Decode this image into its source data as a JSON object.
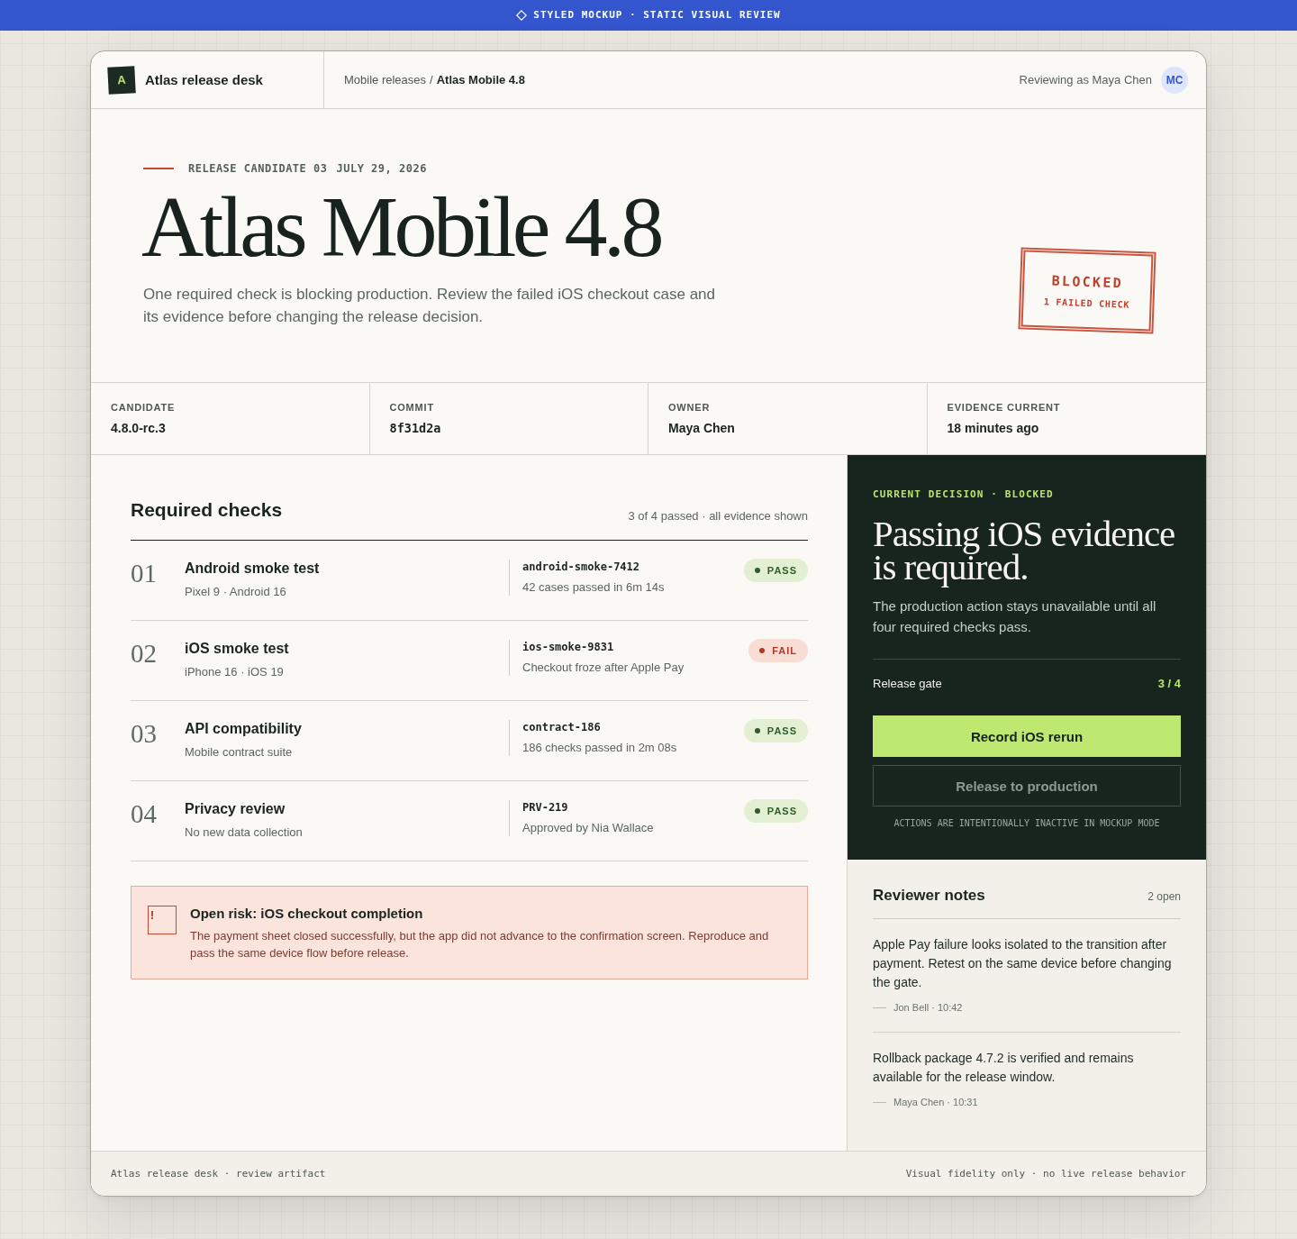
{
  "banner": {
    "text": "STYLED MOCKUP · STATIC VISUAL REVIEW"
  },
  "header": {
    "logo_letter": "A",
    "app_name": "Atlas release desk",
    "breadcrumb": [
      {
        "label": "Mobile releases",
        "current": false
      },
      {
        "label": "Atlas Mobile 4.8",
        "current": true
      }
    ],
    "separator": "/",
    "reviewer_text": "Reviewing as Maya Chen",
    "avatar_initials": "MC"
  },
  "hero": {
    "eyebrow": "RELEASE CANDIDATE 03",
    "date": "JULY 29, 2026",
    "title": "Atlas Mobile 4.8",
    "summary": "One required check is blocking production. Review the failed iOS checkout case and its evidence before changing the release decision.",
    "stamp": {
      "label": "BLOCKED",
      "detail": "1 FAILED CHECK"
    }
  },
  "meta": [
    {
      "label": "CANDIDATE",
      "value": "4.8.0-rc.3",
      "kind": "text"
    },
    {
      "label": "COMMIT",
      "value": "8f31d2a",
      "kind": "code"
    },
    {
      "label": "OWNER",
      "value": "Maya Chen",
      "kind": "text"
    },
    {
      "label": "EVIDENCE CURRENT",
      "value": "18 minutes ago",
      "kind": "text"
    }
  ],
  "checks": {
    "title": "Required checks",
    "summary": "3 of 4 passed · all evidence shown",
    "items": [
      {
        "number": "01",
        "name": "Android smoke test",
        "device": "Pixel 9 · Android 16",
        "evidence_id": "android-smoke-7412",
        "evidence_detail": "42 cases passed in 6m 14s",
        "kind": "pass",
        "badge": "PASS"
      },
      {
        "number": "02",
        "name": "iOS smoke test",
        "device": "iPhone 16 · iOS 19",
        "evidence_id": "ios-smoke-9831",
        "evidence_detail": "Checkout froze after Apple Pay",
        "kind": "fail",
        "badge": "FAIL"
      },
      {
        "number": "03",
        "name": "API compatibility",
        "device": "Mobile contract suite",
        "evidence_id": "contract-186",
        "evidence_detail": "186 checks passed in 2m 08s",
        "kind": "pass",
        "badge": "PASS"
      },
      {
        "number": "04",
        "name": "Privacy review",
        "device": "No new data collection",
        "evidence_id": "PRV-219",
        "evidence_detail": "Approved by Nia Wallace",
        "kind": "pass",
        "badge": "PASS"
      }
    ]
  },
  "risk": {
    "icon": "!",
    "title": "Open risk: iOS checkout completion",
    "body": "The payment sheet closed successfully, but the app did not advance to the confirmation screen. Reproduce and pass the same device flow before release."
  },
  "decision": {
    "eyebrow": "CURRENT DECISION · BLOCKED",
    "headline": "Passing iOS evidence is required.",
    "body": "The production action stays unavailable until all four required checks pass.",
    "gate_label": "Release gate",
    "gate_value": "3 / 4",
    "actions": [
      {
        "label": "Record iOS rerun",
        "kind": "primary",
        "disabled": false
      },
      {
        "label": "Release to production",
        "kind": "secondary",
        "disabled": true
      }
    ],
    "note": "ACTIONS ARE INTENTIONALLY INACTIVE IN MOCKUP MODE"
  },
  "notes": {
    "title": "Reviewer notes",
    "count": "2 open",
    "items": [
      {
        "text": "Apple Pay failure looks isolated to the transition after payment. Retest on the same device before changing the gate.",
        "meta": "Jon Bell · 10:42"
      },
      {
        "text": "Rollback package 4.7.2 is verified and remains available for the release window.",
        "meta": "Maya Chen · 10:31"
      }
    ]
  },
  "footer": {
    "left": "Atlas release desk · review artifact",
    "right": "Visual fidelity only · no live release behavior"
  }
}
